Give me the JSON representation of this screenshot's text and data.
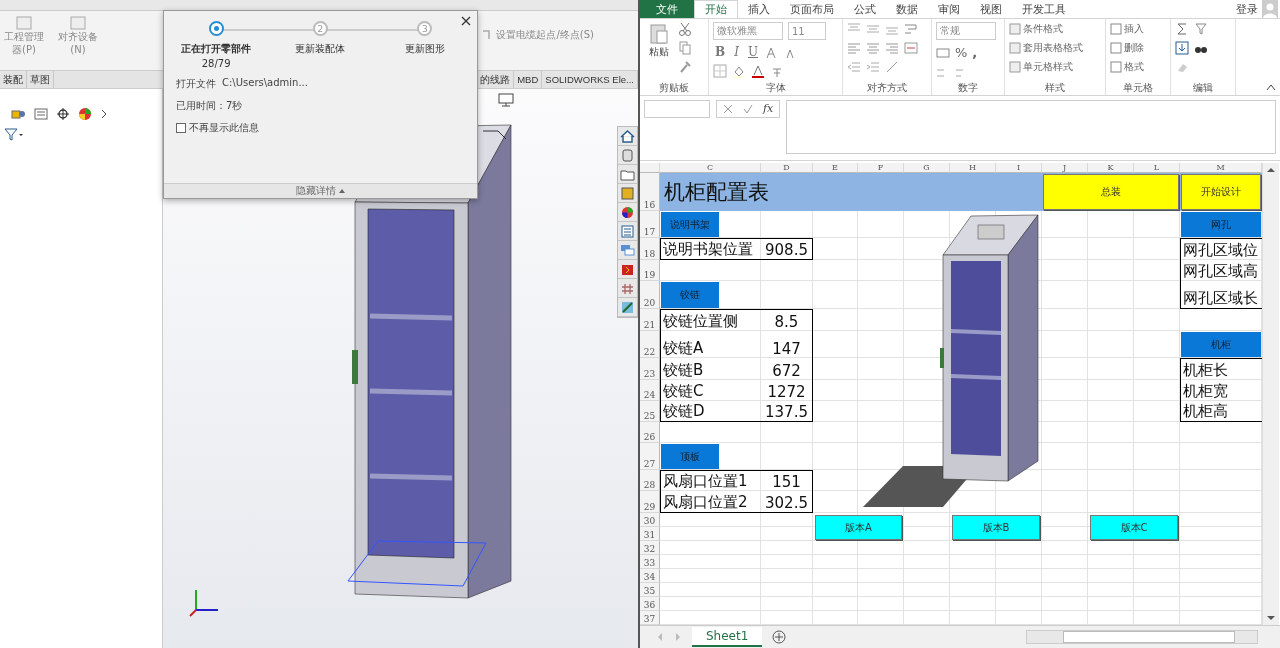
{
  "solidworks": {
    "ribbon_buttons": [
      {
        "label": "工程管理器(P)"
      },
      {
        "label": "对齐设备(N)"
      }
    ],
    "cable_button": "设置电缆起点/终点(S)",
    "tabs": [
      "装配",
      "草图",
      "的线路",
      "MBD",
      "SOLIDWORKS Ele..."
    ],
    "dialog": {
      "steps": [
        {
          "label": "正在打开零部件",
          "detail": "28/79",
          "selected": true
        },
        {
          "number": "2",
          "label": "更新装配体",
          "selected": false
        },
        {
          "number": "3",
          "label": "更新图形",
          "selected": false
        }
      ],
      "file_label": "打开文件",
      "file_path": "C:\\Users\\admin...",
      "elapsed": "已用时间：7秒",
      "dont_show": {
        "label": "不再显示此信息",
        "checked": false
      },
      "toggle": "隐藏详情"
    }
  },
  "excel": {
    "tabs": [
      {
        "label": "文件",
        "kind": "file",
        "selected": false
      },
      {
        "label": "开始",
        "kind": "tab",
        "selected": true
      },
      {
        "label": "插入",
        "kind": "tab",
        "selected": false
      },
      {
        "label": "页面布局",
        "kind": "tab",
        "selected": false
      },
      {
        "label": "公式",
        "kind": "tab",
        "selected": false
      },
      {
        "label": "数据",
        "kind": "tab",
        "selected": false
      },
      {
        "label": "审阅",
        "kind": "tab",
        "selected": false
      },
      {
        "label": "视图",
        "kind": "tab",
        "selected": false
      },
      {
        "label": "开发工具",
        "kind": "tab",
        "selected": false
      }
    ],
    "account": "登录",
    "ribbon": {
      "clipboard": {
        "paste": "粘贴",
        "label": "剪贴板"
      },
      "font": {
        "name": "微软雅黑",
        "size": "11",
        "bold": "B",
        "italic": "I",
        "underline": "U",
        "label": "字体"
      },
      "alignment": {
        "label": "对齐方式"
      },
      "number": {
        "format": "常规",
        "percent": "%",
        "comma": ",",
        "label": "数字"
      },
      "styles": {
        "items": [
          "条件格式",
          "套用表格格式",
          "单元格样式"
        ],
        "label": "样式"
      },
      "cells": {
        "items": [
          "插入",
          "删除",
          "格式"
        ],
        "label": "单元格"
      },
      "editing": {
        "label": "编辑"
      }
    },
    "formula_bar": {
      "fx": "fx"
    },
    "columns": [
      "C",
      "D",
      "E",
      "F",
      "G",
      "H",
      "I",
      "J",
      "K",
      "L",
      "M"
    ],
    "rows": [
      "16",
      "17",
      "18",
      "19",
      "20",
      "21",
      "22",
      "23",
      "24",
      "25",
      "26",
      "27",
      "28",
      "29",
      "30",
      "31",
      "32",
      "33",
      "34",
      "35",
      "36",
      "37"
    ],
    "title": "机柜配置表",
    "action_buttons": [
      {
        "label": "总装"
      },
      {
        "label": "开始设计"
      }
    ],
    "sections": [
      {
        "header": "说明书架",
        "rows": [
          {
            "label": "说明书架位置",
            "value": "908.5"
          }
        ]
      },
      {
        "header": "铰链",
        "rows": [
          {
            "label": "铰链位置侧",
            "value": "8.5"
          },
          {
            "label": "铰链A",
            "value": "147"
          },
          {
            "label": "铰链B",
            "value": "672"
          },
          {
            "label": "铰链C",
            "value": "1272"
          },
          {
            "label": "铰链D",
            "value": "137.5"
          }
        ]
      },
      {
        "header": "顶板",
        "rows": [
          {
            "label": "风扇口位置1",
            "value": "151"
          },
          {
            "label": "风扇口位置2",
            "value": "302.5"
          }
        ]
      },
      {
        "header": "网孔",
        "rows": [
          {
            "label": "网孔区域位"
          },
          {
            "label": "网孔区域高"
          },
          {
            "label": "网孔区域长"
          }
        ]
      },
      {
        "header": "机柜",
        "rows": [
          {
            "label": "机柜长"
          },
          {
            "label": "机柜宽"
          },
          {
            "label": "机柜高"
          }
        ]
      }
    ],
    "version_buttons": [
      {
        "label": "版本A"
      },
      {
        "label": "版本B"
      },
      {
        "label": "版本C"
      }
    ],
    "sheet_tabs": [
      {
        "label": "Sheet1",
        "selected": true
      }
    ]
  }
}
